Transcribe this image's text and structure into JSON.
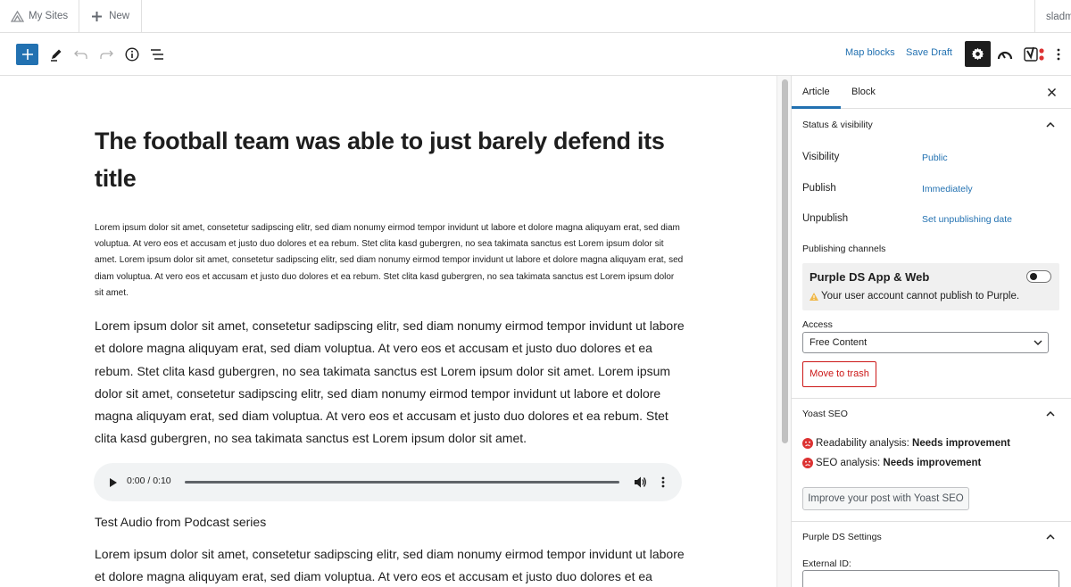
{
  "adminbar": {
    "sites_label": "My Sites",
    "new_label": "New",
    "user_label": "sladmin"
  },
  "toolbar": {
    "map_blocks": "Map blocks",
    "save_draft": "Save Draft"
  },
  "post": {
    "title": "The football team was able to just barely defend its title",
    "para_small": "Lorem ipsum dolor sit amet, consetetur sadipscing elitr, sed diam nonumy eirmod tempor invidunt ut labore et dolore magna aliquyam erat, sed diam voluptua. At vero eos et accusam et justo duo dolores et ea rebum. Stet clita kasd gubergren, no sea takimata sanctus est Lorem ipsum dolor sit amet. Lorem ipsum dolor sit amet, consetetur sadipscing elitr, sed diam nonumy eirmod tempor invidunt ut labore et dolore magna aliquyam erat, sed diam voluptua. At vero eos et accusam et justo duo dolores et ea rebum. Stet clita kasd gubergren, no sea takimata sanctus est Lorem ipsum dolor sit amet.",
    "para_large": "Lorem ipsum dolor sit amet, consetetur sadipscing elitr, sed diam nonumy eirmod tempor invidunt ut labore et dolore magna aliquyam erat, sed diam voluptua. At vero eos et accusam et justo duo dolores et ea rebum. Stet clita kasd gubergren, no sea takimata sanctus est Lorem ipsum dolor sit amet. Lorem ipsum dolor sit amet, consetetur sadipscing elitr, sed diam nonumy eirmod tempor invidunt ut labore et dolore magna aliquyam erat, sed diam voluptua. At vero eos et accusam et justo duo dolores et ea rebum. Stet clita kasd gubergren, no sea takimata sanctus est Lorem ipsum dolor sit amet.",
    "audio_time": "0:00 / 0:10",
    "caption": "Test Audio from Podcast series",
    "para_large_2": "Lorem ipsum dolor sit amet, consetetur sadipscing elitr, sed diam nonumy eirmod tempor invidunt ut labore et dolore magna aliquyam erat, sed diam voluptua. At vero eos et accusam et justo duo dolores et ea rebum."
  },
  "sidebar": {
    "tab_article": "Article",
    "tab_block": "Block",
    "status_title": "Status & visibility",
    "visibility_label": "Visibility",
    "visibility_value": "Public",
    "publish_label": "Publish",
    "publish_value": "Immediately",
    "unpublish_label": "Unpublish",
    "unpublish_value": "Set unpublishing date",
    "channels_label": "Publishing channels",
    "channel_name": "Purple DS App & Web",
    "channel_warning": "Your user account cannot publish to Purple.",
    "access_label": "Access",
    "access_value": "Free Content",
    "trash_label": "Move to trash",
    "yoast_title": "Yoast SEO",
    "readability_prefix": "Readability analysis: ",
    "readability_value": "Needs improvement",
    "seo_prefix": "SEO analysis: ",
    "seo_value": "Needs improvement",
    "yoast_button": "Improve your post with Yoast SEO",
    "purple_title": "Purple DS Settings",
    "external_id_label": "External ID:"
  },
  "colors": {
    "accent": "#2271b1",
    "danger": "#cc1818",
    "warning": "#f0b849"
  }
}
